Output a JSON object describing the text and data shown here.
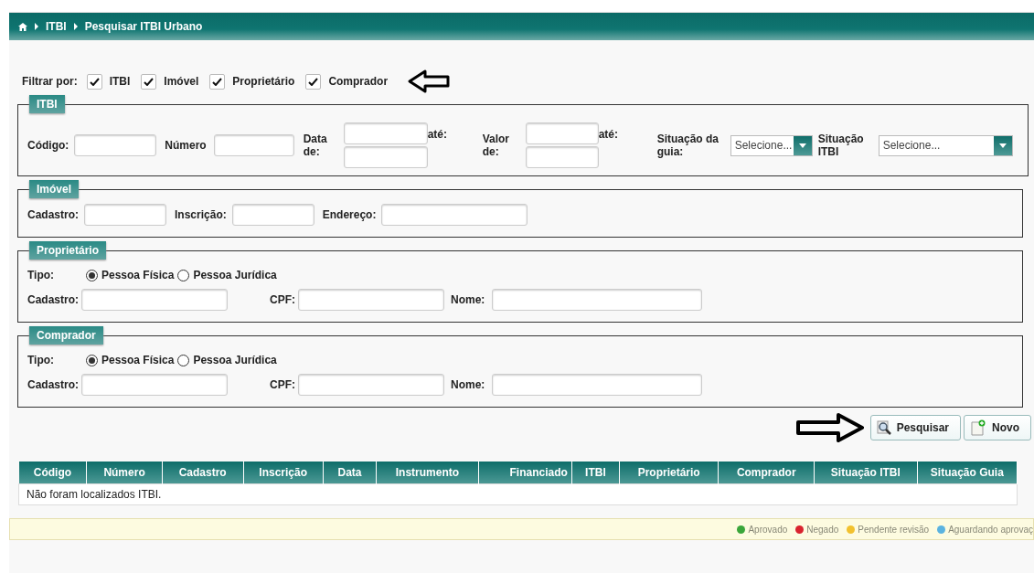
{
  "breadcrumb": [
    "ITBI",
    "Pesquisar ITBI Urbano"
  ],
  "filter": {
    "label": "Filtrar por:",
    "options": [
      {
        "label": "ITBI",
        "checked": true
      },
      {
        "label": "Imóvel",
        "checked": true
      },
      {
        "label": "Proprietário",
        "checked": true
      },
      {
        "label": "Comprador",
        "checked": true
      }
    ]
  },
  "itbi": {
    "title": "ITBI",
    "codigo": "Código:",
    "numero": "Número",
    "data": {
      "label": "Data de:",
      "until": "até:"
    },
    "valor": {
      "label": "Valor de:",
      "until": "até:"
    },
    "selects": [
      {
        "label": "Situação da guia:",
        "placeholder": "Selecione..."
      },
      {
        "label": "Situação ITBI",
        "placeholder": "Selecione..."
      }
    ]
  },
  "imovel": {
    "title": "Imóvel",
    "fields": [
      "Cadastro:",
      "Inscrição:",
      "Endereço:"
    ]
  },
  "people": [
    {
      "title": "Proprietário",
      "tipo": "Tipo:",
      "options": [
        {
          "label": "Pessoa Física",
          "selected": true
        },
        {
          "label": "Pessoa Jurídica",
          "selected": false
        }
      ],
      "fields": [
        "Cadastro:",
        "CPF:",
        "Nome:"
      ]
    },
    {
      "title": "Comprador",
      "tipo": "Tipo:",
      "options": [
        {
          "label": "Pessoa Física",
          "selected": true
        },
        {
          "label": "Pessoa Jurídica",
          "selected": false
        }
      ],
      "fields": [
        "Cadastro:",
        "CPF:",
        "Nome:"
      ]
    }
  ],
  "buttons": [
    {
      "label": "Pesquisar",
      "kind": "search"
    },
    {
      "label": "Novo",
      "kind": "new"
    }
  ],
  "table": {
    "columns": [
      "Código",
      "Número",
      "Cadastro",
      "Inscrição",
      "Data",
      "Instrumento",
      "Financiado",
      "ITBI",
      "Proprietário",
      "Comprador",
      "Situação ITBI",
      "Situação Guia"
    ],
    "empty_message": "Não foram localizados ITBI."
  },
  "legend": [
    {
      "label": "Aprovado",
      "color": "#3aa63a"
    },
    {
      "label": "Negado",
      "color": "#d9232e"
    },
    {
      "label": "Pendente revisão",
      "color": "#f2c12e"
    },
    {
      "label": "Aguardando aprovaç",
      "color": "#5bb3e0"
    }
  ]
}
